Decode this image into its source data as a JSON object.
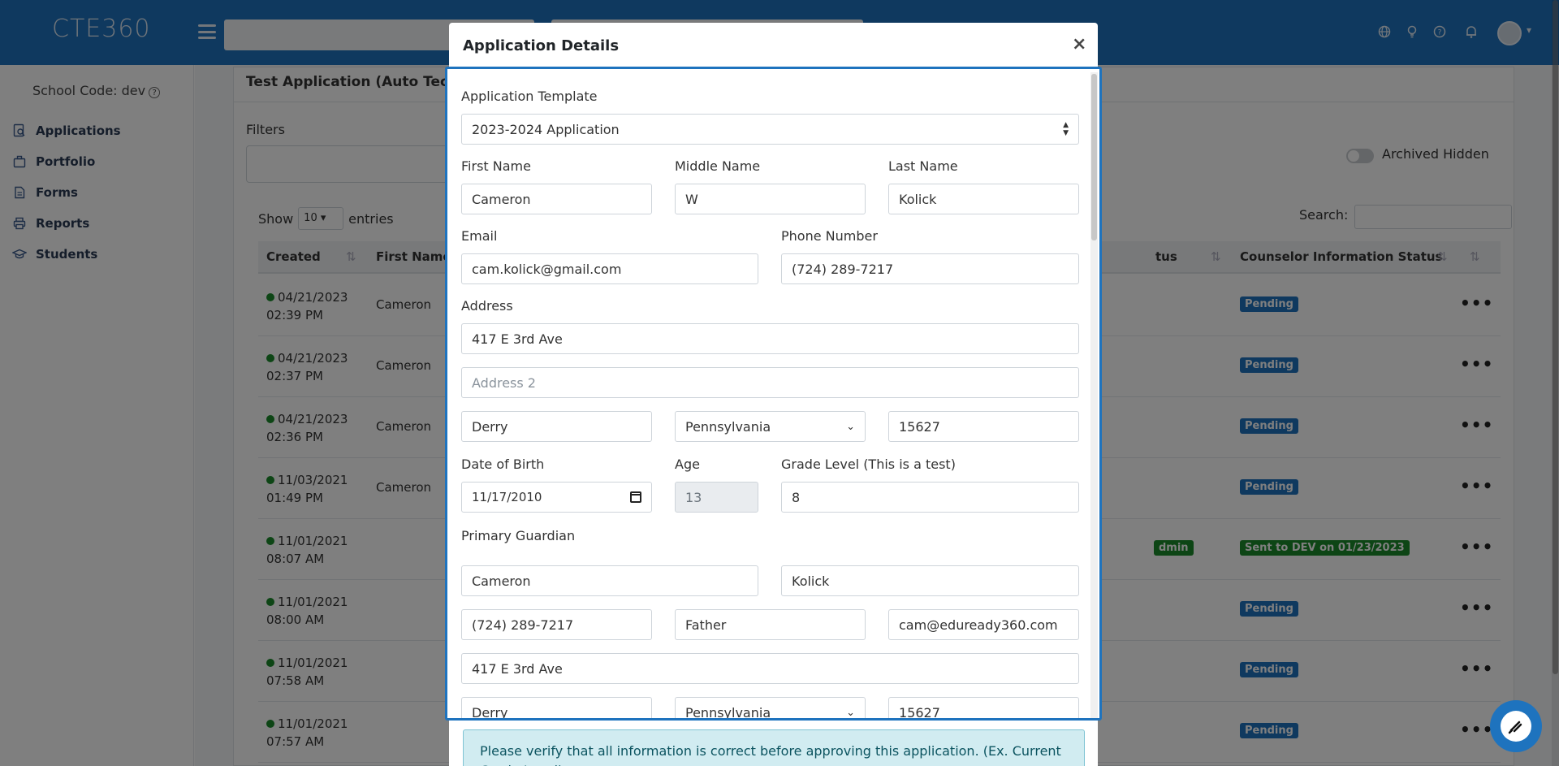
{
  "app": {
    "logo_text": "CTE360"
  },
  "sidebar": {
    "school_code": "School Code: dev",
    "items": [
      {
        "label": "Applications",
        "icon": "search-doc-icon"
      },
      {
        "label": "Portfolio",
        "icon": "briefcase-icon"
      },
      {
        "label": "Forms",
        "icon": "file-icon"
      },
      {
        "label": "Reports",
        "icon": "printer-icon"
      },
      {
        "label": "Students",
        "icon": "graduation-cap-icon"
      }
    ]
  },
  "main": {
    "card_title": "Test Application (Auto Tech)",
    "filters_label": "Filters",
    "archived_label": "Archived Hidden",
    "show_label": "Show",
    "entries_value": "10",
    "entries_label": "entries",
    "search_label": "Search:",
    "columns": {
      "created": "Created",
      "first_name": "First Name",
      "status_fragment": "tus",
      "counselor_status": "Counselor Information Status"
    },
    "rows": [
      {
        "date": "04/21/2023",
        "time": "02:39 PM",
        "first_name": "Cameron",
        "counselor_status": "Pending",
        "mid_badge": ""
      },
      {
        "date": "04/21/2023",
        "time": "02:37 PM",
        "first_name": "Cameron",
        "counselor_status": "Pending",
        "mid_badge": ""
      },
      {
        "date": "04/21/2023",
        "time": "02:36 PM",
        "first_name": "Cameron",
        "counselor_status": "Pending",
        "mid_badge": ""
      },
      {
        "date": "11/03/2021",
        "time": "01:49 PM",
        "first_name": "Cameron",
        "counselor_status": "Pending",
        "mid_badge": ""
      },
      {
        "date": "11/01/2021",
        "time": "08:07 AM",
        "first_name": "",
        "counselor_status": "Sent to DEV on 01/23/2023",
        "mid_badge": "dmin"
      },
      {
        "date": "11/01/2021",
        "time": "08:00 AM",
        "first_name": "",
        "counselor_status": "Pending",
        "mid_badge": ""
      },
      {
        "date": "11/01/2021",
        "time": "07:58 AM",
        "first_name": "",
        "counselor_status": "Pending",
        "mid_badge": ""
      },
      {
        "date": "11/01/2021",
        "time": "07:57 AM",
        "first_name": "",
        "counselor_status": "Pending",
        "mid_badge": ""
      }
    ]
  },
  "modal": {
    "title": "Application Details",
    "close": "×",
    "template_label": "Application Template",
    "template_value": "2023-2024 Application",
    "first_name_label": "First Name",
    "first_name": "Cameron",
    "middle_name_label": "Middle Name",
    "middle_name": "W",
    "last_name_label": "Last Name",
    "last_name": "Kolick",
    "email_label": "Email",
    "email": "cam.kolick@gmail.com",
    "phone_label": "Phone Number",
    "phone": "(724) 289-7217",
    "address_label": "Address",
    "address1": "417 E 3rd Ave",
    "address2_placeholder": "Address 2",
    "city": "Derry",
    "state": "Pennsylvania",
    "zip": "15627",
    "dob_label": "Date of Birth",
    "dob": "11/17/2010",
    "age_label": "Age",
    "age": "13",
    "grade_label": "Grade Level (This is a test)",
    "grade": "8",
    "guardian_label": "Primary Guardian",
    "guardian_first": "Cameron",
    "guardian_last": "Kolick",
    "guardian_phone": "(724) 289-7217",
    "guardian_relation": "Father",
    "guardian_email": "cam@eduready360.com",
    "guardian_address": "417 E 3rd Ave",
    "guardian_city": "Derry",
    "guardian_state": "Pennsylvania",
    "guardian_zip": "15627",
    "verify_text": "Please verify that all information is correct before approving this application. (Ex. Current Grade Level)"
  },
  "colors": {
    "brand_blue": "#1e73be",
    "pending_badge": "#1e73be",
    "success_badge": "#1a8a2b",
    "info_bg": "#d1ecf1"
  }
}
